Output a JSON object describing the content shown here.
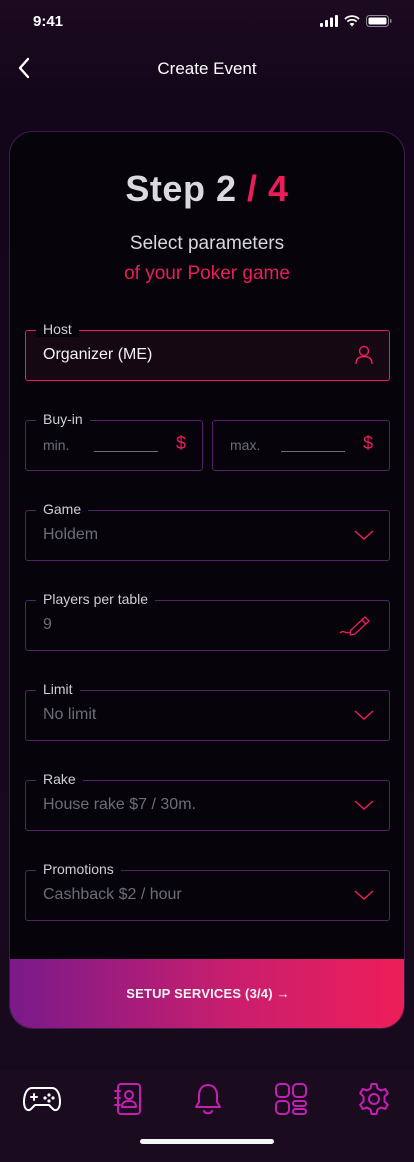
{
  "status": {
    "time": "9:41"
  },
  "nav": {
    "title": "Create Event"
  },
  "step": {
    "label": "Step",
    "current": "2",
    "separator": "/",
    "total": "4"
  },
  "subtitle": {
    "line1": "Select parameters",
    "line2": "of your Poker game"
  },
  "fields": {
    "host": {
      "label": "Host",
      "value": "Organizer (ME)",
      "icon": "user-icon"
    },
    "buyin": {
      "label": "Buy-in",
      "min_placeholder": "min.",
      "max_placeholder": "max.",
      "currency": "$"
    },
    "game": {
      "label": "Game",
      "value": "Holdem"
    },
    "players": {
      "label": "Players per table",
      "value": "9",
      "icon": "pencil-icon"
    },
    "limit": {
      "label": "Limit",
      "value": "No limit"
    },
    "rake": {
      "label": "Rake",
      "value": "House rake $7 / 30m."
    },
    "promotions": {
      "label": "Promotions",
      "value": "Cashback $2 / hour"
    }
  },
  "cta": {
    "label": "SETUP SERVICES (3/4) →"
  },
  "tabs": [
    {
      "name": "games",
      "icon": "gamepad-icon",
      "active": true
    },
    {
      "name": "contacts",
      "icon": "contact-book-icon"
    },
    {
      "name": "notifications",
      "icon": "bell-icon"
    },
    {
      "name": "dashboard",
      "icon": "grid-icon"
    },
    {
      "name": "settings",
      "icon": "gear-icon"
    }
  ],
  "colors": {
    "accent": "#e91e5a",
    "purple": "#5a1e6e",
    "card_bg": "#06040a",
    "tab_icon": "#c41eb4"
  }
}
